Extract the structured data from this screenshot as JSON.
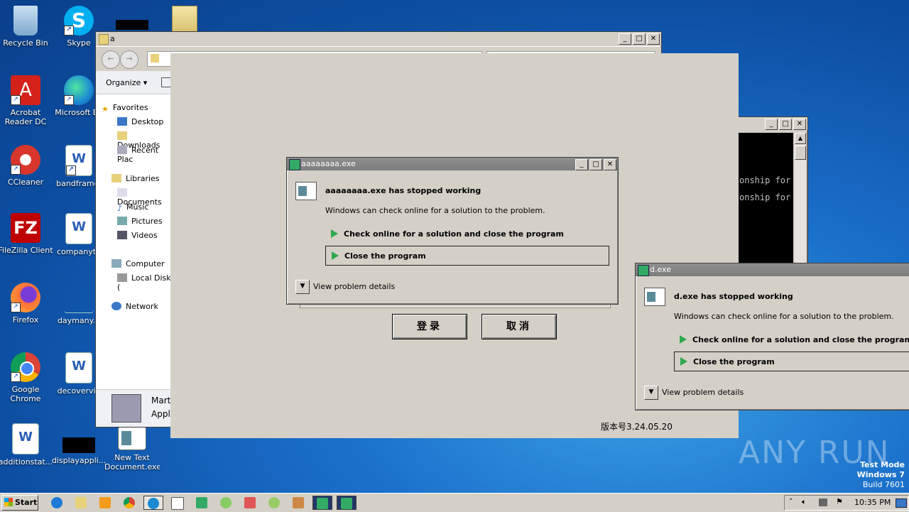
{
  "desktop": {
    "icons": [
      {
        "label": "Recycle Bin",
        "color": "#9ec3e6"
      },
      {
        "label": "Skype",
        "color": "#00aff0"
      },
      {
        "label": "Acrobat\nReader DC",
        "color": "#d4221a"
      },
      {
        "label": "Microsoft Ed",
        "color": "#1b8ad3"
      },
      {
        "label": "CCleaner",
        "color": "#d8362c"
      },
      {
        "label": "bandframe.",
        "color": "#2b5fb4"
      },
      {
        "label": "FileZilla Client",
        "color": "#bf0000"
      },
      {
        "label": "companyth",
        "color": "#2b5fb4"
      },
      {
        "label": "Firefox",
        "color": "#ff7139"
      },
      {
        "label": "daymany.p",
        "color": "#1a6fc9"
      },
      {
        "label": "Google\nChrome",
        "color": "#4caf50"
      },
      {
        "label": "decovervie",
        "color": "#2b5fb4"
      },
      {
        "label": "additionstat...",
        "color": "#2b5fb4"
      },
      {
        "label": "displayappli...",
        "color": "#000000"
      },
      {
        "label": "New Text\nDocument.exe",
        "color": "#5a8a9a"
      }
    ]
  },
  "explorer": {
    "title": "a",
    "organize": "Organize",
    "nav": {
      "favorites": "Favorites",
      "desktop": "Desktop",
      "downloads": "Downloads",
      "recent": "Recent Plac",
      "libraries": "Libraries",
      "documents": "Documents",
      "music": "Music",
      "pictures": "Pictures",
      "videos": "Videos",
      "computer": "Computer",
      "localdisk": "Local Disk (",
      "network": "Network"
    },
    "details": {
      "name": "Mart",
      "type": "Applic"
    }
  },
  "console": {
    "lines": [
      "onship for",
      "onship for"
    ]
  },
  "app_window": {
    "login_label": "登录",
    "cancel_label": "取消",
    "version": "版本号3.24.05.20"
  },
  "error_a": {
    "title": "aaaaaaaa.exe",
    "heading": "aaaaaaaa.exe has stopped working",
    "subtext": "Windows can check online for a solution to the problem.",
    "option1": "Check online for a solution and close the program",
    "option2": "Close the program",
    "details": "View problem details"
  },
  "error_d": {
    "title": "d.exe",
    "heading": "d.exe has stopped working",
    "subtext": "Windows can check online for a solution to the problem.",
    "option1": "Check online for a solution and close the program",
    "option2": "Close the program",
    "details": "View problem details"
  },
  "watermark": {
    "brand": "ANY RUN",
    "line1": "Test Mode",
    "line2": "Windows 7",
    "line3": "Build 7601"
  },
  "taskbar": {
    "start": "Start",
    "clock": "10:35 PM",
    "items": [
      "ie-icon",
      "explorer-icon",
      "media-player-icon",
      "chrome-icon",
      "edge-icon",
      "window-icon",
      "app-icon",
      "sound-icon",
      "network-icon",
      "notepad-icon",
      "setup-icon",
      "error-window-icon",
      "error-window-icon"
    ]
  },
  "colors": {
    "accent": "#0a3f8a",
    "titlebar": "#808080",
    "dialog": "#d4d0c8",
    "green_arrow": "#2fa84f"
  }
}
